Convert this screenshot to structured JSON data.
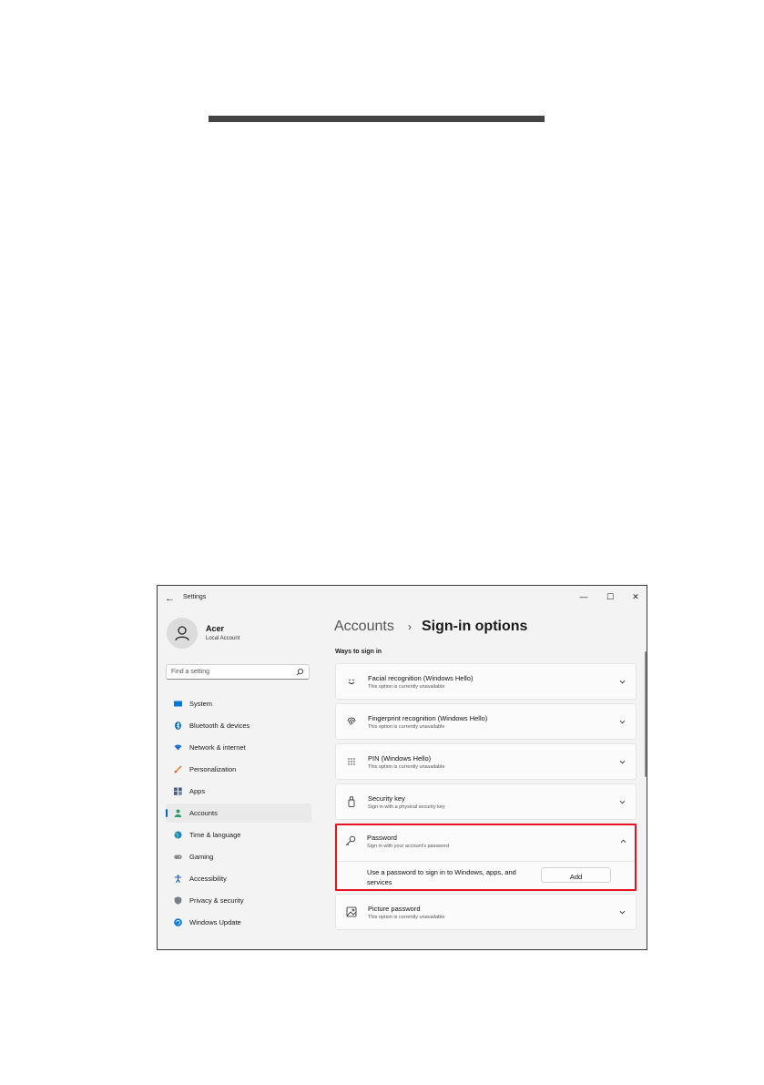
{
  "window": {
    "app_title": "Settings",
    "back_icon": "back-arrow-icon",
    "controls": {
      "minimize": "—",
      "maximize": "☐",
      "close": "✕"
    }
  },
  "user": {
    "name": "Acer",
    "account_type": "Local Account",
    "avatar_icon": "person-icon"
  },
  "search": {
    "placeholder": "Find a setting",
    "icon": "search-icon"
  },
  "nav": [
    {
      "label": "System",
      "icon": "monitor-icon",
      "color": "#0078d4"
    },
    {
      "label": "Bluetooth & devices",
      "icon": "bluetooth-icon",
      "color": "#0067c0"
    },
    {
      "label": "Network & internet",
      "icon": "wifi-icon",
      "color": "#1f6fd6"
    },
    {
      "label": "Personalization",
      "icon": "brush-icon",
      "color": "#e8853c"
    },
    {
      "label": "Apps",
      "icon": "apps-icon",
      "color": "#4a5f7f"
    },
    {
      "label": "Accounts",
      "icon": "person-icon",
      "color": "#2a9d6a",
      "active": true
    },
    {
      "label": "Time & language",
      "icon": "globe-icon",
      "color": "#1a86c8"
    },
    {
      "label": "Gaming",
      "icon": "gamepad-icon",
      "color": "#8a8a8a"
    },
    {
      "label": "Accessibility",
      "icon": "accessibility-icon",
      "color": "#1a5fb4"
    },
    {
      "label": "Privacy & security",
      "icon": "shield-icon",
      "color": "#7a7f87"
    },
    {
      "label": "Windows Update",
      "icon": "update-icon",
      "color": "#0078d4"
    }
  ],
  "breadcrumb": {
    "parent": "Accounts",
    "separator": "›",
    "current": "Sign-in options"
  },
  "section": {
    "title": "Ways to sign in"
  },
  "options": [
    {
      "title": "Facial recognition (Windows Hello)",
      "subtitle": "This option is currently unavailable",
      "icon": "face-icon"
    },
    {
      "title": "Fingerprint recognition (Windows Hello)",
      "subtitle": "This option is currently unavailable",
      "icon": "fingerprint-icon"
    },
    {
      "title": "PIN (Windows Hello)",
      "subtitle": "This option is currently unavailable",
      "icon": "keypad-icon"
    },
    {
      "title": "Security key",
      "subtitle": "Sign in with a physical security key",
      "icon": "usb-key-icon"
    },
    {
      "title": "Password",
      "subtitle": "Sign in with your account's password",
      "icon": "key-icon",
      "expanded": true,
      "detail": "Use a password to sign in to Windows, apps, and services",
      "action_label": "Add"
    },
    {
      "title": "Picture password",
      "subtitle": "This option is currently unavailable",
      "icon": "picture-icon"
    }
  ],
  "highlight_color": "#e81123"
}
